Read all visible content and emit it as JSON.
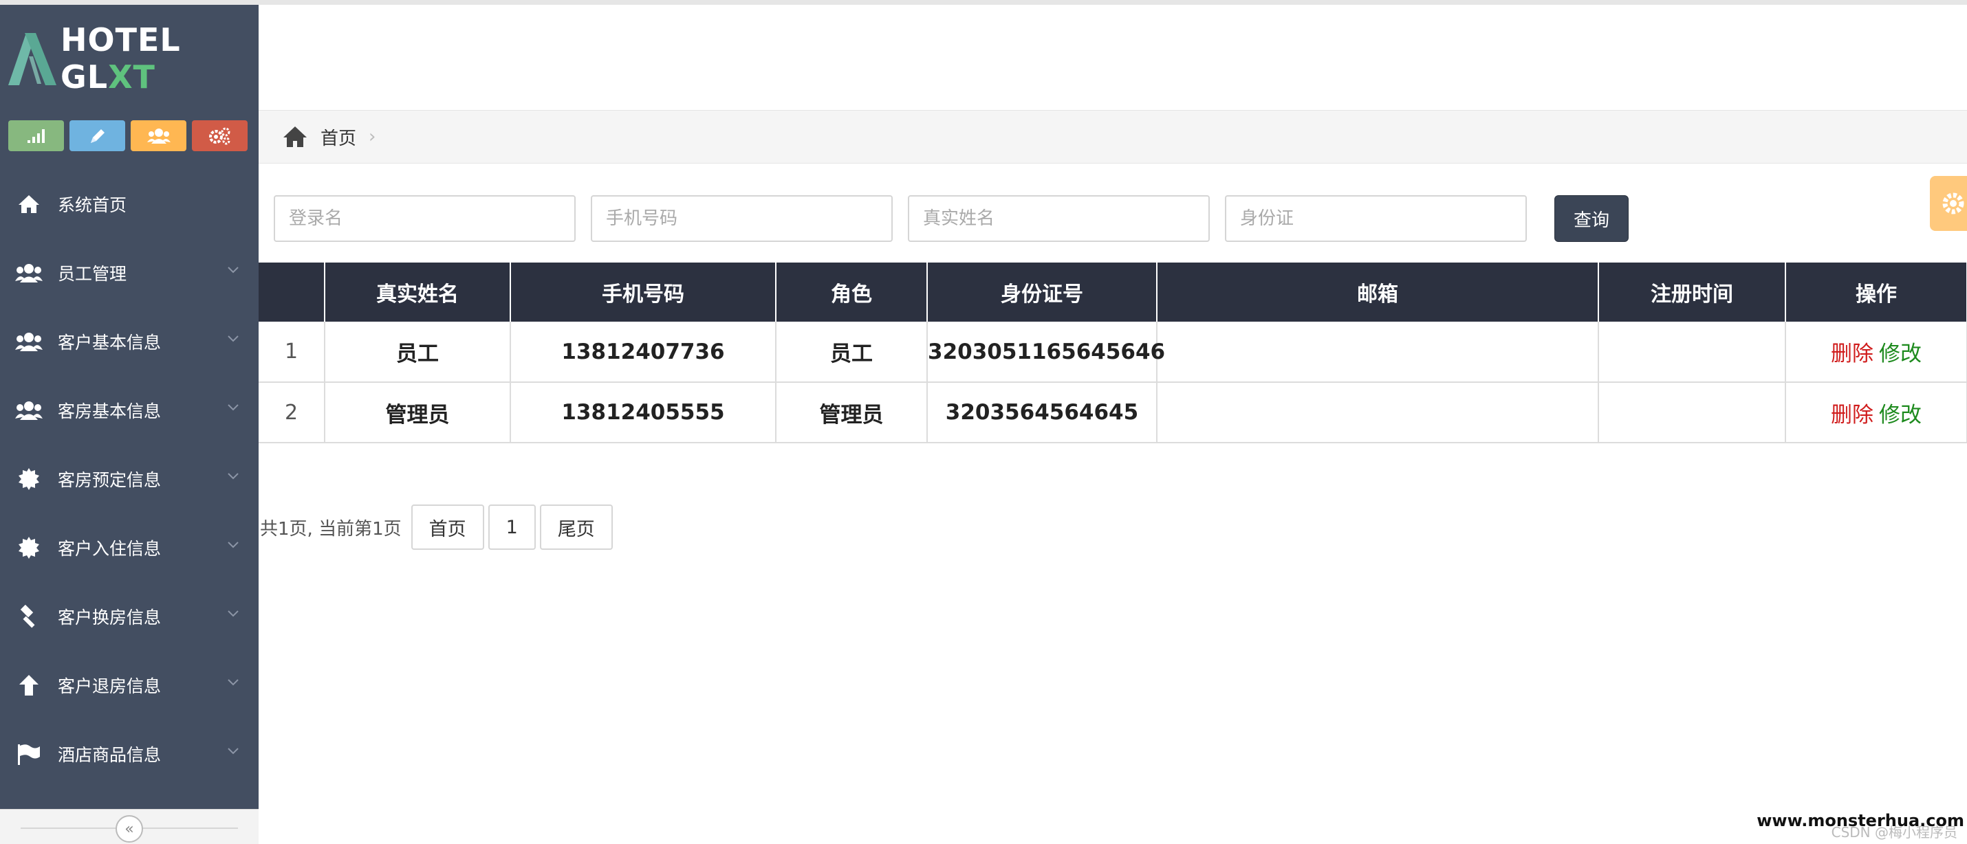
{
  "app": {
    "logo_text_main": "HOTEL GL",
    "logo_text_accent": "XT"
  },
  "shortcuts": [
    {
      "name": "signal",
      "color": "#87b87f"
    },
    {
      "name": "pencil",
      "color": "#6fb3e0"
    },
    {
      "name": "users",
      "color": "#ffb752"
    },
    {
      "name": "cogs",
      "color": "#d15b47"
    }
  ],
  "sidebar": {
    "items": [
      {
        "label": "系统首页",
        "icon": "home-icon",
        "has_submenu": false
      },
      {
        "label": "员工管理",
        "icon": "users-icon",
        "has_submenu": true
      },
      {
        "label": "客户基本信息",
        "icon": "users-icon",
        "has_submenu": true
      },
      {
        "label": "客房基本信息",
        "icon": "users-icon",
        "has_submenu": true
      },
      {
        "label": "客房预定信息",
        "icon": "certificate-icon",
        "has_submenu": true
      },
      {
        "label": "客户入住信息",
        "icon": "certificate-icon",
        "has_submenu": true
      },
      {
        "label": "客户换房信息",
        "icon": "gavel-icon",
        "has_submenu": true
      },
      {
        "label": "客户退房信息",
        "icon": "arrow-up-icon",
        "has_submenu": true
      },
      {
        "label": "酒店商品信息",
        "icon": "flag-icon",
        "has_submenu": true
      }
    ],
    "collapse_glyph": "«"
  },
  "breadcrumb": {
    "home": "首页",
    "separator": "›"
  },
  "search": {
    "login_placeholder": "登录名",
    "phone_placeholder": "手机号码",
    "realname_placeholder": "真实姓名",
    "idcard_placeholder": "身份证",
    "submit_label": "查询"
  },
  "table": {
    "columns": [
      "",
      "真实姓名",
      "手机号码",
      "角色",
      "身份证号",
      "邮箱",
      "注册时间",
      "操作"
    ],
    "rows": [
      {
        "index": "1",
        "real_name": "员工",
        "phone": "13812407736",
        "role": "员工",
        "id_number": "3203051165645646",
        "email": "",
        "register_time": "",
        "delete_label": "删除",
        "edit_label": "修改"
      },
      {
        "index": "2",
        "real_name": "管理员",
        "phone": "13812405555",
        "role": "管理员",
        "id_number": "3203564564645",
        "email": "",
        "register_time": "",
        "delete_label": "删除",
        "edit_label": "修改"
      }
    ]
  },
  "pager": {
    "info": "共1页, 当前第1页",
    "first_label": "首页",
    "current_page": "1",
    "last_label": "尾页"
  },
  "watermark": {
    "site": "www.monsterhua.com",
    "csdn": "CSDN @梅小程序员"
  },
  "colors": {
    "sidebar_bg": "#434e61",
    "table_header_bg": "#2c3140",
    "delete": "#d01d1d",
    "edit": "#1d8a1d",
    "logo_accent": "#5fc27e"
  }
}
